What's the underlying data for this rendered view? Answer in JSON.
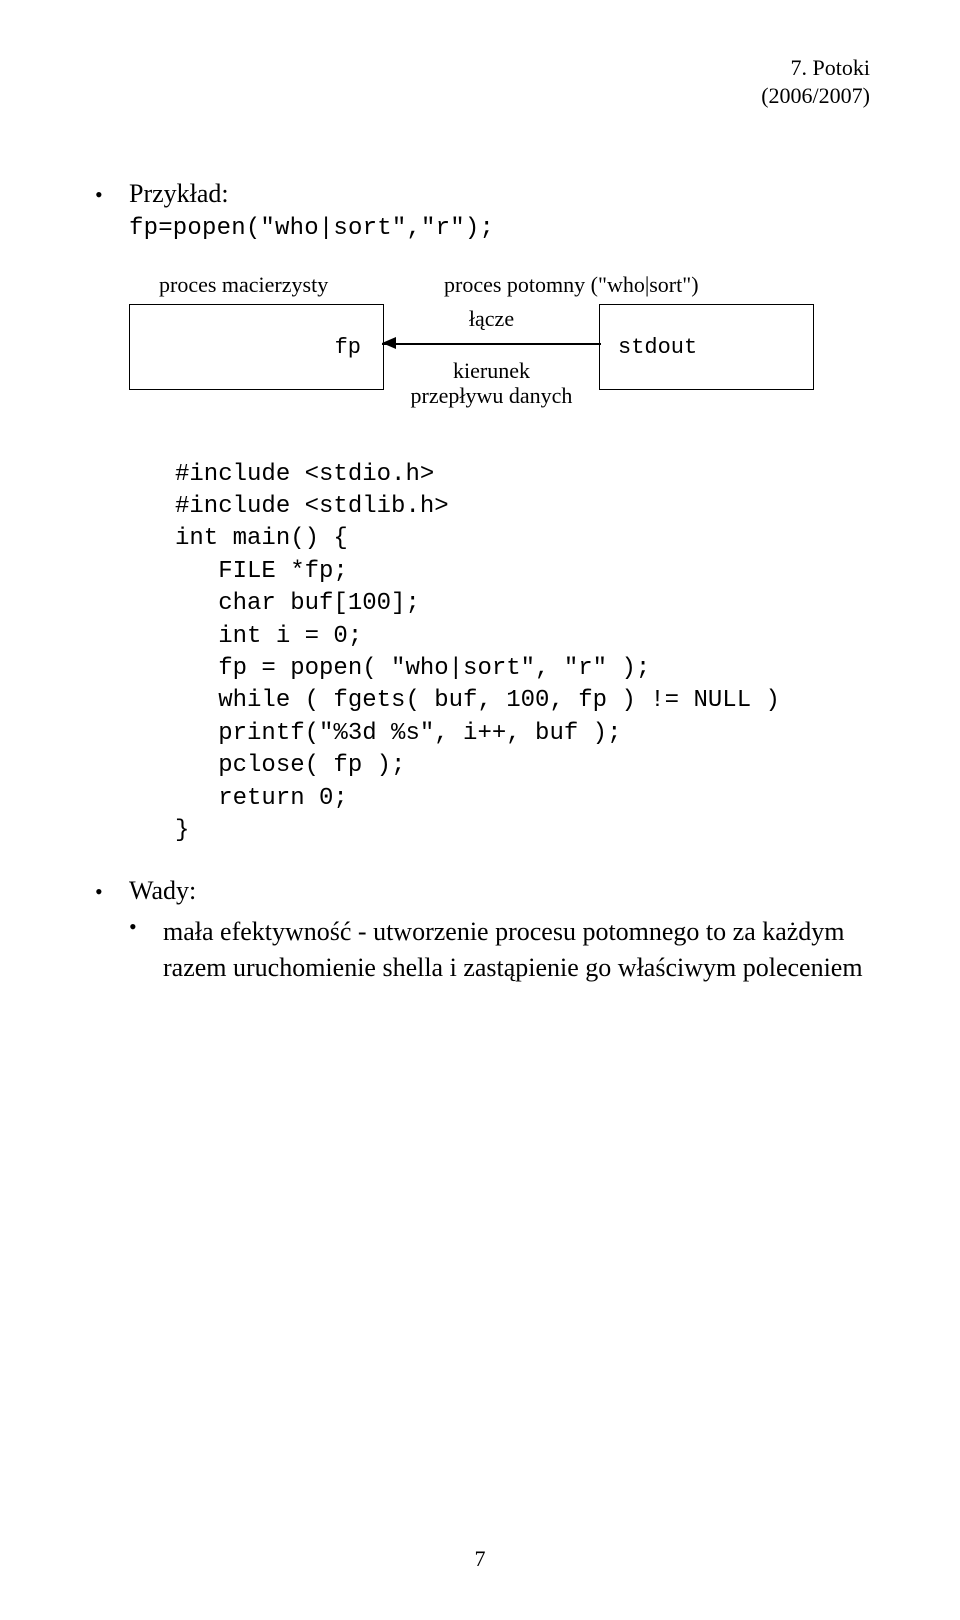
{
  "header": {
    "title": "7. Potoki",
    "year": "(2006/2007)"
  },
  "example": {
    "label": "Przykład:",
    "code_line": "fp=popen(\"who|sort\",\"r\");"
  },
  "diagram": {
    "parent_label": "proces macierzysty",
    "child_label": "proces potomny (\"who|sort\")",
    "fp": "fp",
    "stdout": "stdout",
    "lacze": "łącze",
    "kierunek1": "kierunek",
    "kierunek2": "przepływu danych"
  },
  "code": "#include <stdio.h>\n#include <stdlib.h>\nint main() {\n   FILE *fp;\n   char buf[100];\n   int i = 0;\n   fp = popen( \"who|sort\", \"r\" );\n   while ( fgets( buf, 100, fp ) != NULL )\n   printf(\"%3d %s\", i++, buf );\n   pclose( fp );\n   return 0;\n}",
  "wady": {
    "heading": "Wady:",
    "item": "mała efektywność - utworzenie procesu potomnego to za każdym razem uruchomienie shella i zastąpienie go właściwym poleceniem"
  },
  "page_number": "7"
}
